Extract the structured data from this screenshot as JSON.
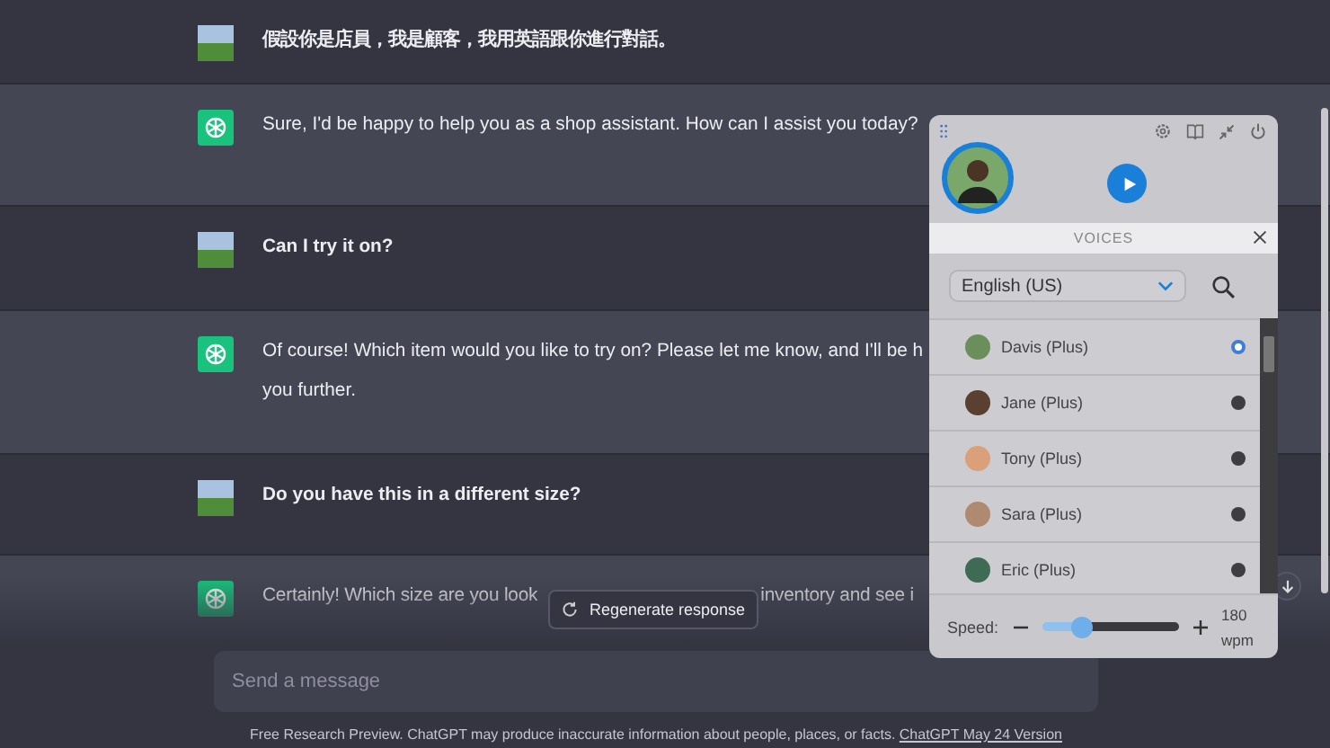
{
  "messages": [
    {
      "kind": "user",
      "lines": [
        "假設你是店員，我是顧客，我用英語跟你進行對話。"
      ]
    },
    {
      "kind": "assistant",
      "lines": [
        "Sure, I'd be happy to help you as a shop assistant. How can I assist you today?"
      ]
    },
    {
      "kind": "user",
      "lines": [
        "Can  I try it on?"
      ]
    },
    {
      "kind": "assistant",
      "lines": [
        "Of course! Which item would you like to try on? Please let me know, and I'll be h",
        "you further."
      ]
    },
    {
      "kind": "user",
      "lines": [
        "Do you have this in a different size?"
      ]
    },
    {
      "kind": "assistant",
      "fragments": [
        "Certainly! Which size are you look",
        "inventory and see i"
      ]
    }
  ],
  "regenerate_button": {
    "label": "Regenerate response"
  },
  "composer": {
    "placeholder": "Send a message"
  },
  "footer": {
    "text": "Free Research Preview. ChatGPT may produce inaccurate information about people, places, or facts.",
    "link": "ChatGPT May 24 Version"
  },
  "voice_panel": {
    "header": "VOICES",
    "language": "English (US)",
    "voices": [
      {
        "name": "Davis (Plus)",
        "selected": true,
        "color": "#6b8f5a"
      },
      {
        "name": "Jane (Plus)",
        "selected": false,
        "color": "#5a4030"
      },
      {
        "name": "Tony (Plus)",
        "selected": false,
        "color": "#d9a07a"
      },
      {
        "name": "Sara (Plus)",
        "selected": false,
        "color": "#b08a70"
      },
      {
        "name": "Eric (Plus)",
        "selected": false,
        "color": "#3f6b55"
      }
    ],
    "speed": {
      "label": "Speed:",
      "level": 0.3,
      "value": "180",
      "unit": "wpm"
    }
  }
}
